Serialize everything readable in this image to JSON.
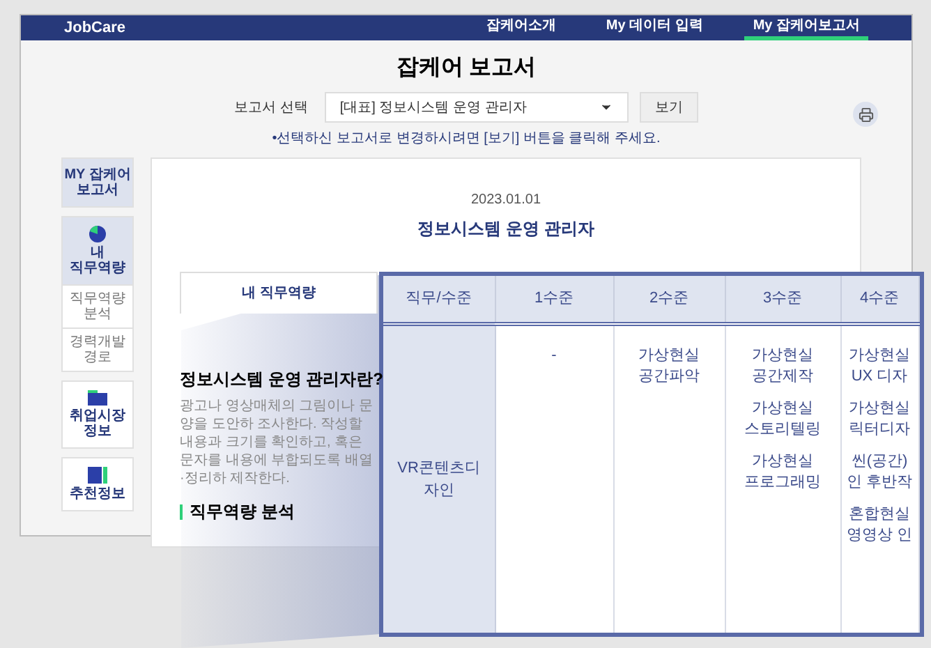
{
  "nav": {
    "logo": "JobCare",
    "items": [
      {
        "label": "잡케어소개",
        "selected": false
      },
      {
        "label": "My 데이터 입력",
        "selected": false
      },
      {
        "label": "My 잡케어보고서",
        "selected": true
      }
    ]
  },
  "page_title": "잡케어 보고서",
  "report_select": {
    "label": "보고서 선택",
    "value": "[대표] 정보시스템 운영 관리자",
    "button": "보기",
    "note": "•선택하신 보고서로 변경하시려면 [보기] 버튼을 클릭해 주세요."
  },
  "sidebar": [
    {
      "label": "MY 잡케어 보고서",
      "kind": "plain",
      "selected": true
    },
    {
      "label": "내 직무역량",
      "kind": "pie",
      "selected": true,
      "children": [
        {
          "label": "직무역량 분석"
        },
        {
          "label": "경력개발 경로"
        }
      ]
    },
    {
      "label": "취업시장 정보",
      "kind": "folder",
      "selected": false
    },
    {
      "label": "추천정보",
      "kind": "book",
      "selected": false
    }
  ],
  "report": {
    "date": "2023.01.01",
    "title": "정보시스템 운영 관리자",
    "tab": "내 직무역량",
    "heading": "정보시스템 운영 관리자란?",
    "description": "광고나 영상매체의 그림이나 문양을 도안하 조사한다. 작성할 내용과 크기를 확인하고, 혹은 문자를 내용에 부합되도록 배열·정리하 제작한다.",
    "section": "직무역량 분석"
  },
  "callout_table": {
    "columns": [
      "직무/수준",
      "1수준",
      "2수준",
      "3수준",
      "4수준"
    ],
    "rows": [
      {
        "cells": [
          [
            "VR콘텐츠디자인"
          ],
          [
            "-"
          ],
          [
            "가상현실 공간파악"
          ],
          [
            "가상현실 공간제작",
            "가상현실 스토리텔링",
            "가상현실 프로그래밍"
          ],
          [
            "가상현실 UX 디자",
            "가상현실 릭터디자",
            "씬(공간) 인 후반작",
            "혼합현실 영영상 인"
          ]
        ]
      }
    ]
  }
}
